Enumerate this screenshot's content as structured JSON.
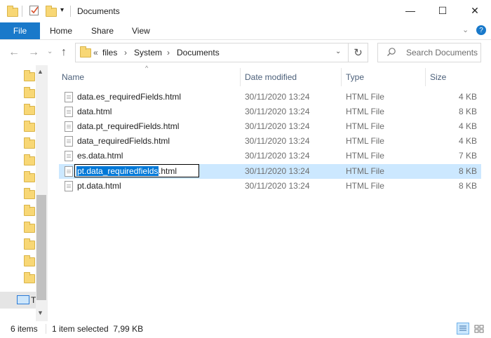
{
  "window": {
    "title": "Documents",
    "controls": {
      "minimize": "—",
      "maximize": "☐",
      "close": "✕"
    }
  },
  "ribbon": {
    "tabs": [
      "File",
      "Home",
      "Share",
      "View"
    ]
  },
  "address": {
    "crumbs": [
      "files",
      "System",
      "Documents"
    ],
    "overflow": "«"
  },
  "search": {
    "placeholder": "Search Documents"
  },
  "columns": {
    "name": "Name",
    "date": "Date modified",
    "type": "Type",
    "size": "Size"
  },
  "files": [
    {
      "name": "data.es_requiredFields.html",
      "date": "30/11/2020 13:24",
      "type": "HTML File",
      "size": "4 KB"
    },
    {
      "name": "data.html",
      "date": "30/11/2020 13:24",
      "type": "HTML File",
      "size": "8 KB"
    },
    {
      "name": "data.pt_requiredFields.html",
      "date": "30/11/2020 13:24",
      "type": "HTML File",
      "size": "4 KB"
    },
    {
      "name": "data_requiredFields.html",
      "date": "30/11/2020 13:24",
      "type": "HTML File",
      "size": "4 KB"
    },
    {
      "name": "es.data.html",
      "date": "30/11/2020 13:24",
      "type": "HTML File",
      "size": "7 KB"
    },
    {
      "name": "pt.data_requiredfields.html",
      "date": "30/11/2020 13:24",
      "type": "HTML File",
      "size": "8 KB"
    },
    {
      "name": "pt.data.html",
      "date": "30/11/2020 13:24",
      "type": "HTML File",
      "size": "8 KB"
    }
  ],
  "rename": {
    "selected_text": "pt.data_requiredfields",
    "rest_text": ".html"
  },
  "status": {
    "count": "6 items",
    "selection": "1 item selected  7,99 KB"
  },
  "nav_pane": {
    "this_pc_label": "T"
  }
}
